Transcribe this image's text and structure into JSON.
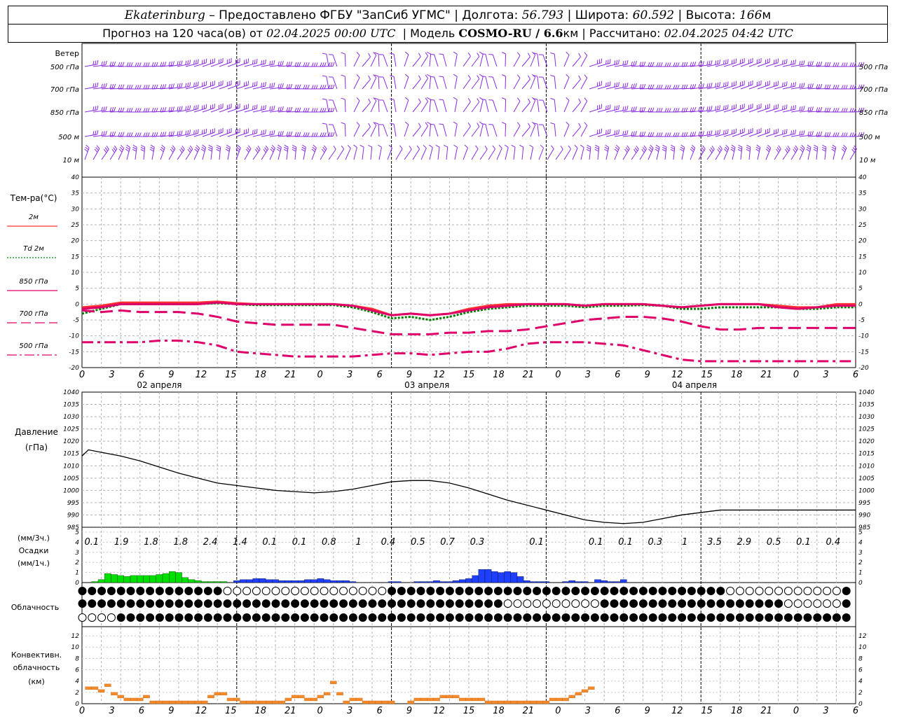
{
  "header": {
    "station": "Ekaterinburg",
    "provider": "– Предоставлено ФГБУ \"ЗапСиб УГМС\"",
    "lon_label": "Долгота:",
    "lon_value": "56.793",
    "lat_label": "Широта:",
    "lat_value": "60.592",
    "alt_label": "Высота:",
    "alt_value": "166",
    "alt_unit": "м",
    "forecast_text": "Прогноз на 120 часа(ов) от",
    "forecast_start": "02.04.2025 00:00 UTC",
    "model_label": "Модель",
    "model_name": "COSMO-RU / 6.6",
    "model_unit": "км",
    "calc_label": "Рассчитано:",
    "calc_time": "02.04.2025 04:42 UTC"
  },
  "wind_panel": {
    "title": "Ветер",
    "levels": [
      "500 гПа",
      "700 гПа",
      "850 гПа",
      "500 м",
      "10 м"
    ],
    "colors": {
      "barb": "#8a2be2"
    }
  },
  "temp_panel": {
    "title": "Тем-ра(°C)",
    "legend": [
      {
        "label": "2м",
        "color": "#ff3030",
        "dash": "solid"
      },
      {
        "label": "Td 2м",
        "color": "#008000",
        "dash": "dotted"
      },
      {
        "label": "850 гПа",
        "color": "#e0006a",
        "dash": "solid"
      },
      {
        "label": "700 гПа",
        "color": "#e0006a",
        "dash": "dashed"
      },
      {
        "label": "500 гПа",
        "color": "#e0006a",
        "dash": "dashdot"
      }
    ]
  },
  "time_axis": {
    "hour_ticks": [
      "0",
      "3",
      "6",
      "9",
      "12",
      "15",
      "18",
      "21",
      "0",
      "3",
      "6",
      "9",
      "12",
      "15",
      "18",
      "21",
      "0",
      "3",
      "6",
      "9",
      "12",
      "15",
      "18",
      "21",
      "0",
      "3",
      "6"
    ],
    "days": [
      "02 апреля",
      "03 апреля",
      "04 апреля"
    ]
  },
  "pressure_panel": {
    "title": "Давление",
    "unit": "(гПа)"
  },
  "precip_panel": {
    "unit3": "(мм/3ч.)",
    "title": "Осадки",
    "unit1": "(мм/1ч.)",
    "labels_3h": [
      "0.1",
      "1.9",
      "1.8",
      "1.8",
      "2.4",
      "1.4",
      "0.1",
      "0.1",
      "0.8",
      "1",
      "0.4",
      "0.5",
      "0.7",
      "0.3",
      "",
      "0.1",
      "",
      "0.1",
      "0.1",
      "0.3",
      "1",
      "3.5",
      "2.9",
      "0.5",
      "0.1",
      "0.4"
    ]
  },
  "cloud_panel": {
    "title": "Облачность"
  },
  "conv_panel": {
    "title1": "Конвективн.",
    "title2": "облачность",
    "unit": "(км)"
  },
  "chart_data": [
    {
      "type": "line",
      "title": "Тем-ра(°C)",
      "x_hours": [
        0,
        3,
        6,
        9,
        12,
        15,
        18,
        21,
        24,
        27,
        30,
        33,
        36,
        39,
        42,
        45,
        48,
        51,
        54,
        57,
        60,
        63,
        66,
        69,
        72,
        75,
        78,
        81,
        84,
        87,
        90,
        93,
        96,
        99,
        102,
        105,
        108,
        111,
        114,
        117,
        120
      ],
      "ylim": [
        -20,
        40
      ],
      "series": [
        {
          "name": "2м",
          "values": [
            -1,
            -0.5,
            0.5,
            0.5,
            0.5,
            0.5,
            0.5,
            0.8,
            0.3,
            0,
            0,
            0,
            0,
            0,
            -0.5,
            -1.5,
            -3.5,
            -3,
            -3.5,
            -3,
            -1.5,
            -0.5,
            0,
            0,
            0,
            0,
            -0.5,
            0,
            0,
            0,
            -0.5,
            -1,
            -0.5,
            0,
            0,
            0,
            -0.5,
            -1,
            -1,
            0,
            0
          ]
        },
        {
          "name": "Td 2м",
          "values": [
            -3,
            -1.5,
            0,
            0,
            0,
            0,
            0,
            0.3,
            0,
            -0.3,
            -0.3,
            -0.3,
            -0.3,
            -0.3,
            -1,
            -2.5,
            -4.5,
            -4,
            -5,
            -4,
            -2.5,
            -1.5,
            -1,
            -0.5,
            -0.5,
            -0.5,
            -1,
            -0.5,
            -0.5,
            -0.3,
            -0.5,
            -1.5,
            -1.5,
            -1,
            -1,
            -1,
            -1,
            -1.5,
            -1.5,
            -1,
            -1
          ]
        },
        {
          "name": "850 гПа",
          "values": [
            -1.5,
            -1,
            0,
            0,
            0,
            0,
            0,
            0.5,
            0,
            0,
            0,
            0,
            0,
            0,
            -0.5,
            -2,
            -3.5,
            -3,
            -3.5,
            -3,
            -2,
            -1,
            -0.5,
            0,
            0,
            0,
            -0.5,
            0,
            0,
            0,
            -0.5,
            -1,
            -0.5,
            0,
            0,
            0,
            -1,
            -1.5,
            -1,
            -0.5,
            -0.5
          ]
        },
        {
          "name": "700 гПа",
          "values": [
            -2,
            -2.5,
            -2,
            -2.5,
            -2.5,
            -2.5,
            -3,
            -4,
            -5.5,
            -6,
            -6.5,
            -6.5,
            -6.5,
            -6.5,
            -7.5,
            -8.5,
            -9.5,
            -9.5,
            -9.5,
            -9,
            -9,
            -8.5,
            -8.5,
            -8,
            -7,
            -6,
            -5,
            -4.5,
            -4,
            -4,
            -4.5,
            -5.5,
            -7,
            -8,
            -8,
            -7.5,
            -7.5,
            -7.5,
            -7.5,
            -7.5,
            -7.5
          ]
        },
        {
          "name": "500 гПа",
          "values": [
            -12,
            -12,
            -12,
            -12,
            -11.5,
            -11.5,
            -12,
            -13,
            -15,
            -15.5,
            -16,
            -16.5,
            -16.5,
            -16.5,
            -16.5,
            -16,
            -15.5,
            -15.5,
            -16,
            -15.5,
            -15,
            -15,
            -14,
            -12.5,
            -12,
            -12,
            -12,
            -12.5,
            -13,
            -14.5,
            -16,
            -17.5,
            -18,
            -18,
            -18,
            -18,
            -18,
            -18,
            -18,
            -18,
            -18
          ]
        }
      ]
    },
    {
      "type": "line",
      "title": "Давление",
      "ylabel": "(гПа)",
      "ylim": [
        985,
        1040
      ],
      "x_hours": [
        0,
        1,
        3,
        6,
        9,
        12,
        15,
        18,
        21,
        24,
        27,
        30,
        33,
        36,
        39,
        42,
        45,
        48,
        51,
        54,
        57,
        60,
        63,
        66,
        69,
        72,
        75,
        78,
        81,
        84,
        87,
        90,
        93,
        96,
        99,
        102,
        105,
        108,
        111,
        114,
        117,
        120
      ],
      "values": [
        1014,
        1016.5,
        1015.5,
        1014,
        1012,
        1009.5,
        1007,
        1005,
        1003,
        1002,
        1001,
        1000,
        999.5,
        999,
        999.5,
        1000.5,
        1002,
        1003.5,
        1004,
        1004,
        1003,
        1001,
        998.5,
        996,
        994,
        992,
        990,
        988,
        987,
        986.5,
        987,
        988.5,
        990,
        991,
        992,
        992,
        992,
        992,
        992,
        992,
        992,
        992
      ]
    },
    {
      "type": "bar",
      "title": "Осадки",
      "ylabel": "(мм/1ч.)",
      "ylim": [
        0,
        5
      ],
      "x_hours": [
        2,
        3,
        4,
        5,
        6,
        7,
        8,
        9,
        10,
        11,
        12,
        13,
        14,
        15,
        16,
        17,
        18,
        19,
        20,
        21,
        22,
        24,
        25,
        26,
        27,
        28,
        29,
        30,
        31,
        32,
        33,
        34,
        35,
        36,
        37,
        38,
        39,
        40,
        41,
        42,
        48,
        49,
        52,
        53,
        54,
        55,
        56,
        57,
        58,
        59,
        60,
        61,
        62,
        63,
        64,
        65,
        66,
        67,
        68,
        69,
        70,
        71,
        72,
        75,
        76,
        77,
        78,
        80,
        81,
        82,
        83,
        84
      ],
      "series": [
        {
          "name": "green",
          "color": "#00e000",
          "values": [
            0.1,
            0.3,
            0.9,
            0.8,
            0.7,
            0.6,
            0.7,
            0.7,
            0.7,
            0.7,
            0.8,
            0.9,
            1.1,
            1.0,
            0.5,
            0.3,
            0.2,
            0.1,
            0.1,
            0.1,
            0.1,
            0,
            0,
            0,
            0,
            0,
            0,
            0,
            0,
            0,
            0,
            0,
            0,
            0,
            0,
            0,
            0,
            0,
            0,
            0,
            0,
            0,
            0,
            0,
            0,
            0,
            0,
            0,
            0,
            0,
            0,
            0,
            0,
            0,
            0,
            0,
            0,
            0,
            0,
            0,
            0,
            0,
            0,
            0,
            0,
            0,
            0,
            0,
            0,
            0,
            0,
            0
          ]
        },
        {
          "name": "blue",
          "color": "#1f3fff",
          "values": [
            0,
            0,
            0,
            0,
            0,
            0,
            0,
            0,
            0,
            0,
            0,
            0,
            0,
            0,
            0,
            0,
            0,
            0,
            0,
            0,
            0,
            0.2,
            0.3,
            0.3,
            0.4,
            0.4,
            0.3,
            0.3,
            0.2,
            0.2,
            0.2,
            0.2,
            0.3,
            0.3,
            0.4,
            0.3,
            0.2,
            0.2,
            0.2,
            0.1,
            0.1,
            0.1,
            0.1,
            0.1,
            0.1,
            0.2,
            0.1,
            0.1,
            0.2,
            0.3,
            0.4,
            0.7,
            1.3,
            1.3,
            1.1,
            1.0,
            1.1,
            1.0,
            0.6,
            0.2,
            0.1,
            0.1,
            0.1,
            0.1,
            0.2,
            0.1,
            0.1,
            0.3,
            0.2,
            0.1,
            0.1,
            0.3
          ]
        }
      ]
    },
    {
      "type": "bar",
      "title": "Конвективн. облачность",
      "ylabel": "(км)",
      "ylim": [
        0,
        13
      ],
      "x_hours": [
        1,
        2,
        3,
        4,
        5,
        6,
        7,
        8,
        9,
        10,
        11,
        12,
        13,
        14,
        15,
        16,
        17,
        18,
        19,
        20,
        21,
        22,
        23,
        24,
        25,
        26,
        27,
        28,
        29,
        30,
        31,
        32,
        33,
        34,
        35,
        36,
        37,
        38,
        39,
        40,
        41,
        42,
        43,
        44,
        45,
        46,
        47,
        48,
        51,
        52,
        53,
        54,
        55,
        56,
        57,
        58,
        59,
        60,
        61,
        62,
        63,
        64,
        65,
        66,
        67,
        68,
        69,
        70,
        71,
        72,
        73,
        74,
        75,
        76,
        77,
        78,
        79
      ],
      "values": [
        3,
        3,
        2.5,
        3.5,
        2,
        1.5,
        1,
        1,
        1,
        1.5,
        0.5,
        0.5,
        0.5,
        0.5,
        0.5,
        0.5,
        0.5,
        0.5,
        0.5,
        1.5,
        2,
        2,
        1,
        1,
        0.5,
        0.5,
        0.5,
        0.5,
        0.5,
        0.5,
        0.5,
        1,
        1.5,
        1.5,
        1,
        1,
        1.5,
        2,
        4,
        2,
        0.5,
        1,
        1,
        0.5,
        0.5,
        0.5,
        0.5,
        0.5,
        0.5,
        1,
        1,
        1,
        1,
        1.5,
        1.5,
        1.5,
        1,
        1,
        1,
        1,
        0.5,
        0.5,
        0.5,
        0.5,
        0.5,
        0.5,
        0.5,
        0.5,
        0.5,
        0.5,
        1,
        1,
        1,
        1.5,
        2,
        2.5,
        3
      ]
    }
  ]
}
